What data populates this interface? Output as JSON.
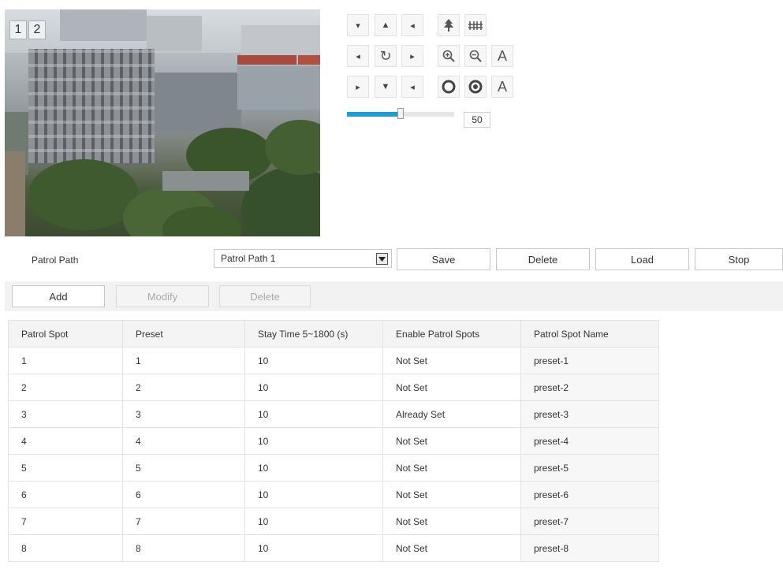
{
  "preview": {
    "channel_buttons": [
      "1",
      "2"
    ]
  },
  "ptz": {
    "buttons": [
      {
        "name": "pan-up-left-icon",
        "glyph": "▾"
      },
      {
        "name": "pan-up-icon",
        "glyph": "▲"
      },
      {
        "name": "pan-up-right-icon",
        "glyph": "◂"
      },
      {
        "name": "left-icon",
        "glyph": "◂"
      },
      {
        "name": "auto-pan-icon",
        "glyph": "↻"
      },
      {
        "name": "right-icon",
        "glyph": "▸"
      },
      {
        "name": "down-left-icon",
        "glyph": "▸"
      },
      {
        "name": "down-icon",
        "glyph": "▼"
      },
      {
        "name": "down-right-icon",
        "glyph": "◂"
      }
    ],
    "focus_far_icon": "tree-icon",
    "focus_near_icon": "fence-icon",
    "zoom_in_icon": "zoom-in-icon",
    "zoom_out_icon": "zoom-out-icon",
    "auto_focus_label": "A",
    "iris_open_icon": "iris-open-icon",
    "iris_close_icon": "iris-close-icon",
    "auto_iris_label": "A",
    "speed": {
      "value": "50",
      "level_percent": 50,
      "fill_color": "#1a9fd4"
    }
  },
  "patrol": {
    "label": "Patrol Path",
    "selected_path": "Patrol Path 1",
    "buttons": {
      "save": "Save",
      "delete": "Delete",
      "load": "Load",
      "stop": "Stop"
    }
  },
  "toolbar": {
    "add": "Add",
    "modify": "Modify",
    "delete": "Delete"
  },
  "table": {
    "headers": [
      "Patrol Spot",
      "Preset",
      "Stay Time 5~1800 (s)",
      "Enable Patrol Spots",
      "Patrol Spot Name"
    ],
    "rows": [
      [
        "1",
        "1",
        "10",
        "Not Set",
        "preset-1"
      ],
      [
        "2",
        "2",
        "10",
        "Not Set",
        "preset-2"
      ],
      [
        "3",
        "3",
        "10",
        "Already Set",
        "preset-3"
      ],
      [
        "4",
        "4",
        "10",
        "Not Set",
        "preset-4"
      ],
      [
        "5",
        "5",
        "10",
        "Not Set",
        "preset-5"
      ],
      [
        "6",
        "6",
        "10",
        "Not Set",
        "preset-6"
      ],
      [
        "7",
        "7",
        "10",
        "Not Set",
        "preset-7"
      ],
      [
        "8",
        "8",
        "10",
        "Not Set",
        "preset-8"
      ]
    ]
  }
}
